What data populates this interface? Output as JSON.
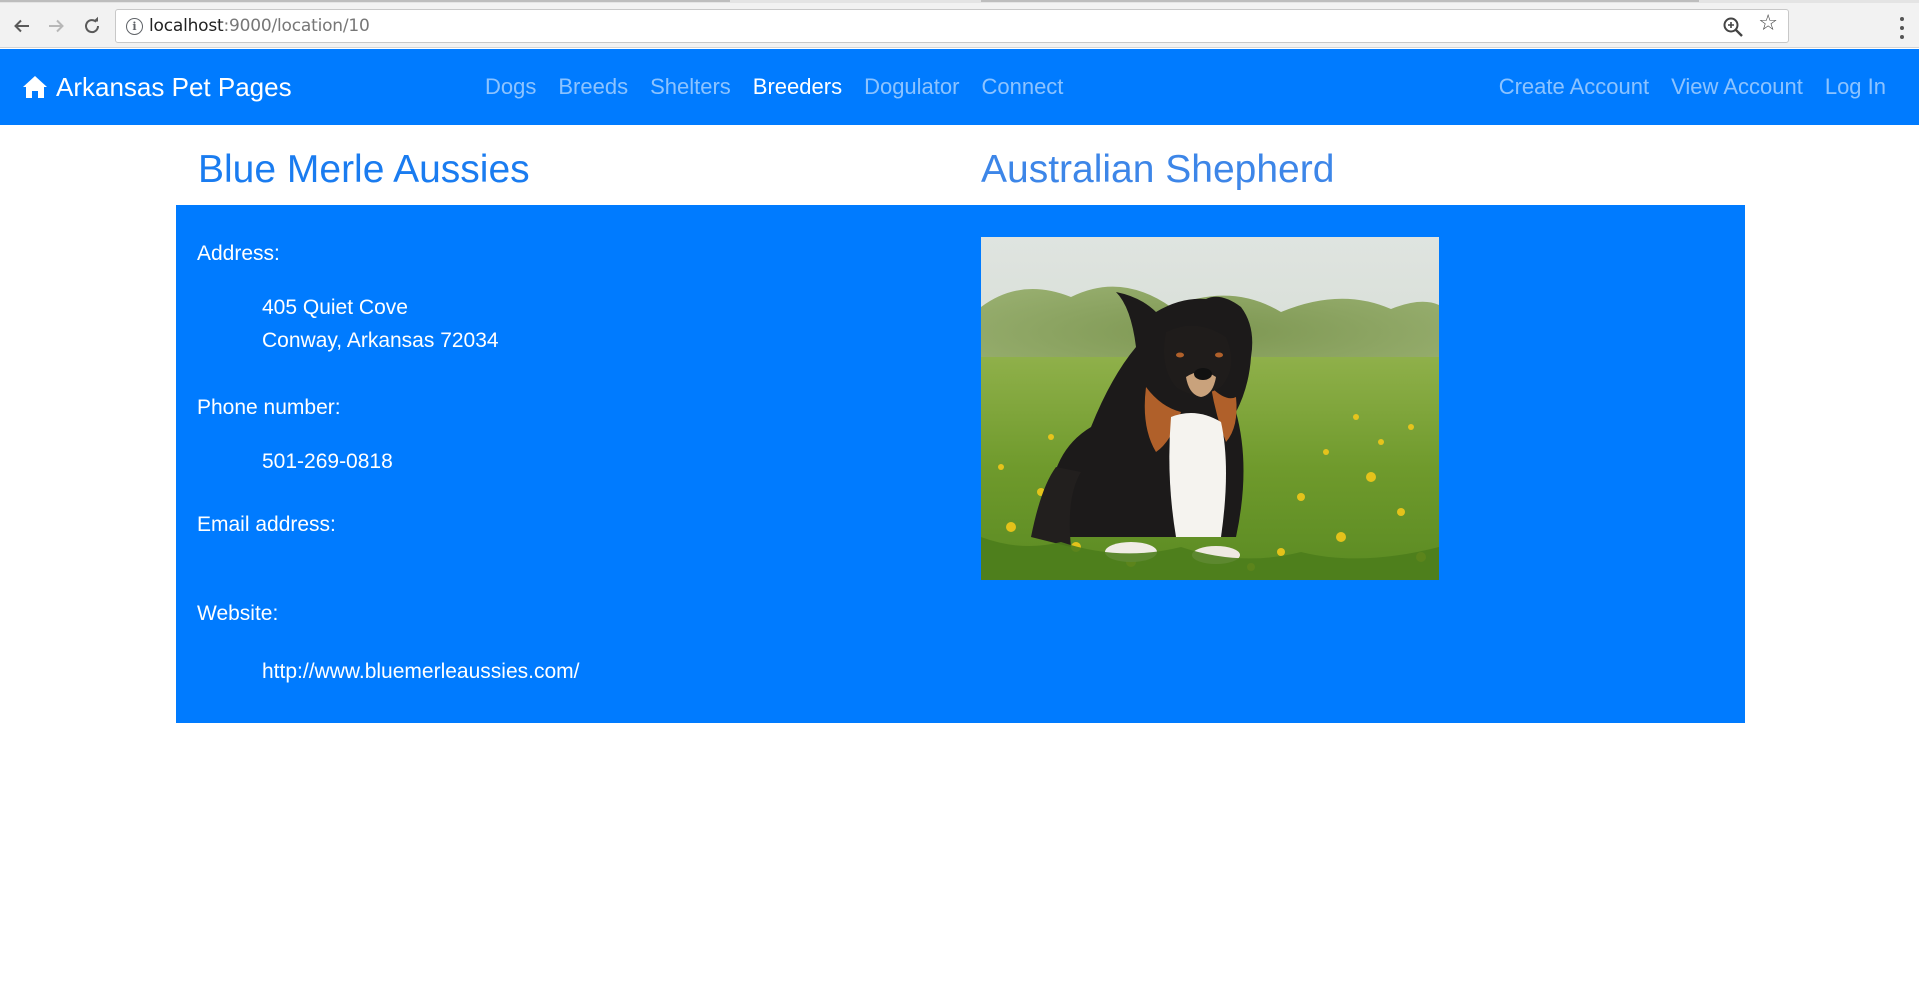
{
  "browser": {
    "url_host": "localhost",
    "url_rest": ":9000/location/10",
    "icons": {
      "back": "arrow-left-icon",
      "forward": "arrow-right-icon",
      "reload": "reload-icon",
      "info": "info-icon",
      "zoom": "zoom-icon",
      "bookmark": "star-icon",
      "menu": "kebab-menu-icon"
    }
  },
  "navbar": {
    "brand": "Arkansas Pet Pages",
    "links": [
      {
        "label": "Dogs",
        "active": false
      },
      {
        "label": "Breeds",
        "active": false
      },
      {
        "label": "Shelters",
        "active": false
      },
      {
        "label": "Breeders",
        "active": true
      },
      {
        "label": "Dogulator",
        "active": false
      },
      {
        "label": "Connect",
        "active": false
      }
    ],
    "right_links": [
      "Create Account",
      "View Account",
      "Log In"
    ],
    "background_color": "#007bff"
  },
  "breeder": {
    "name": "Blue Merle Aussies",
    "breed": "Australian Shepherd",
    "address_label": "Address:",
    "address_line1": "405 Quiet Cove",
    "address_line2": "Conway, Arkansas 72034",
    "phone_label": "Phone number:",
    "phone": "501-269-0818",
    "email_label": "Email address:",
    "email": "",
    "website_label": "Website:",
    "website": "http://www.bluemerleaussies.com/",
    "photo": "australian-shepherd-in-dandelion-field"
  }
}
